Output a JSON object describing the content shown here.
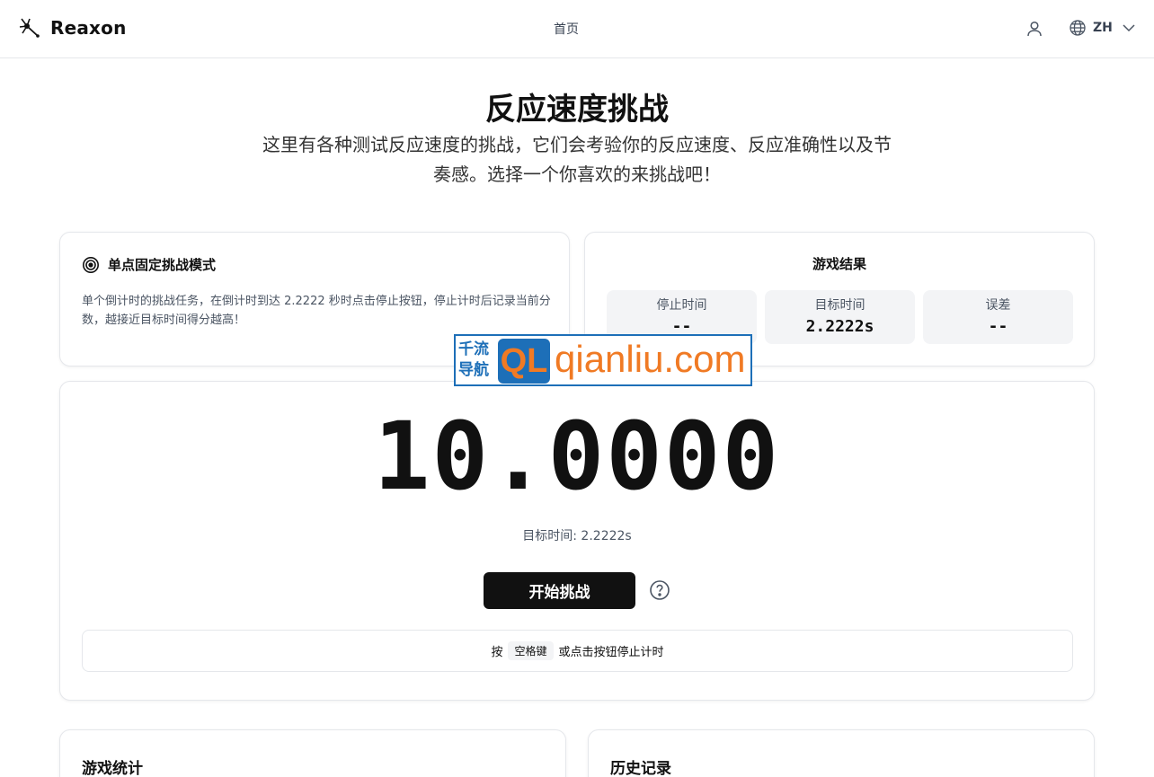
{
  "header": {
    "brand": "Reaxon",
    "nav_home": "首页",
    "lang": "ZH"
  },
  "hero": {
    "title": "反应速度挑战",
    "description": "这里有各种测试反应速度的挑战，它们会考验你的反应速度、反应准确性以及节奏感。选择一个你喜欢的来挑战吧！"
  },
  "mode": {
    "title": "单点固定挑战模式",
    "description": "单个倒计时的挑战任务，在倒计时到达 2.2222 秒时点击停止按钮，停止计时后记录当前分数，越接近目标时间得分越高！"
  },
  "result": {
    "title": "游戏结果",
    "stop_label": "停止时间",
    "stop_value": "--",
    "target_label": "目标时间",
    "target_value": "2.2222s",
    "error_label": "误差",
    "error_value": "--"
  },
  "game": {
    "timer": "10.0000",
    "target_line": "目标时间: 2.2222s",
    "start_label": "开始挑战",
    "hint_prefix": "按",
    "hint_key": "空格键",
    "hint_suffix": "或点击按钮停止计时"
  },
  "sections": {
    "stats_title": "游戏统计",
    "history_title": "历史记录"
  },
  "watermark": {
    "cn_line1": "千流",
    "cn_line2": "导航",
    "badge": "QL",
    "url": "qianliu.com"
  },
  "colors": {
    "primary_button": "#111111",
    "watermark_blue": "#1d6fb8",
    "watermark_orange": "#f07a24"
  }
}
